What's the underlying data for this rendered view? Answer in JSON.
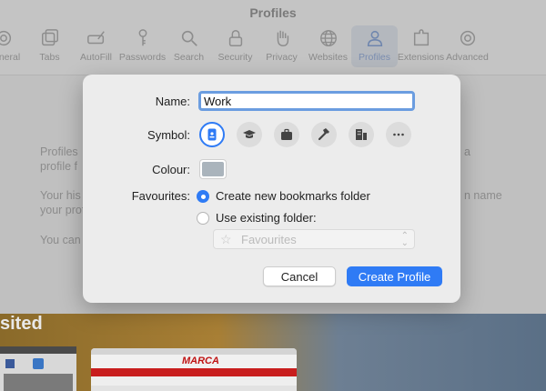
{
  "window": {
    "title": "Profiles",
    "toolbar": [
      {
        "label": "General",
        "icon": "gear-icon"
      },
      {
        "label": "Tabs",
        "icon": "tabs-icon"
      },
      {
        "label": "AutoFill",
        "icon": "autofill-pencil-icon"
      },
      {
        "label": "Passwords",
        "icon": "key-icon"
      },
      {
        "label": "Search",
        "icon": "search-icon"
      },
      {
        "label": "Security",
        "icon": "lock-icon"
      },
      {
        "label": "Privacy",
        "icon": "hand-icon"
      },
      {
        "label": "Websites",
        "icon": "globe-icon"
      },
      {
        "label": "Profiles",
        "icon": "person-icon",
        "active": true
      },
      {
        "label": "Extensions",
        "icon": "puzzle-icon"
      },
      {
        "label": "Advanced",
        "icon": "gear-icon"
      }
    ],
    "background_text": {
      "line1a": "Profiles",
      "line1b": "a",
      "line2": "profile f",
      "line3a": "Your his",
      "line3b": "n name",
      "line4": "your prof",
      "line5": "You can"
    }
  },
  "bottom": {
    "section_label": "sited",
    "thumb2_logo": "MARCA"
  },
  "dialog": {
    "name_label": "Name:",
    "name_value": "Work",
    "symbol_label": "Symbol:",
    "symbols": [
      "id-badge-icon",
      "graduation-cap-icon",
      "briefcase-icon",
      "hammer-icon",
      "building-icon",
      "more-icon"
    ],
    "selected_symbol": "id-badge-icon",
    "colour_label": "Colour:",
    "colour_value": "#aab4bc",
    "favourites_label": "Favourites:",
    "option_new": "Create new bookmarks folder",
    "option_existing": "Use existing folder:",
    "selected_option": "new",
    "folder_select_value": "Favourites",
    "cancel_label": "Cancel",
    "create_label": "Create Profile"
  },
  "colors": {
    "accent": "#2f7bf5"
  }
}
